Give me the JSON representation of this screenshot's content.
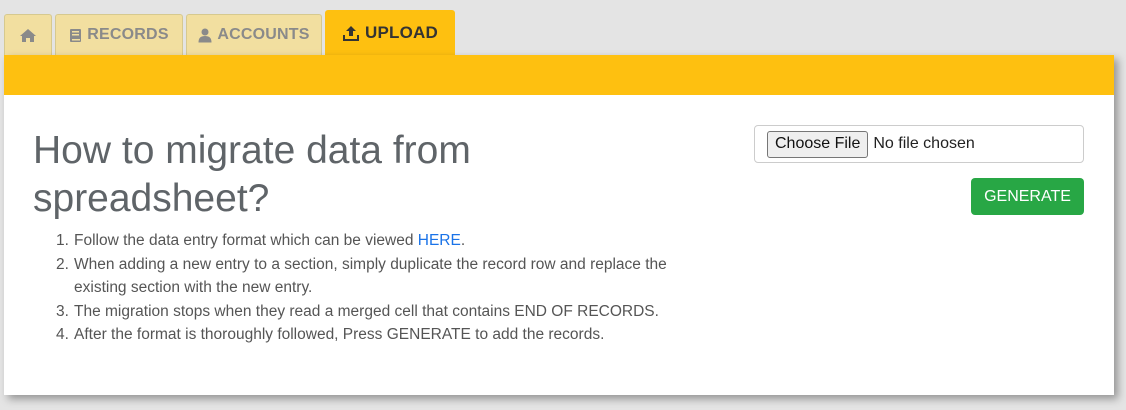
{
  "tabs": {
    "home": {
      "icon": "home-icon"
    },
    "records": {
      "label": "RECORDS",
      "icon": "book-icon"
    },
    "accounts": {
      "label": "ACCOUNTS",
      "icon": "user-icon"
    },
    "upload": {
      "label": "UPLOAD",
      "icon": "upload-icon",
      "active": true
    }
  },
  "main": {
    "title_line1": "How to migrate data from",
    "title_line2": "spreadsheet?",
    "steps": [
      {
        "num": "1.",
        "text": "Follow the data entry format which can be viewed ",
        "link": "HERE",
        "after": "."
      },
      {
        "num": "2.",
        "line1": "When adding a new entry to a section, simply duplicate the record row and replace the",
        "line2": "existing section with the new entry."
      },
      {
        "num": "3.",
        "text": "The migration stops when they read a merged cell that contains END OF RECORDS."
      },
      {
        "num": "4.",
        "text": "After the format is thoroughly followed, Press GENERATE to add the records."
      }
    ]
  },
  "upload": {
    "choose_file_label": "Choose File",
    "file_status": "No file chosen",
    "generate_label": "GENERATE"
  },
  "colors": {
    "accent": "#fec010",
    "tab_inactive": "#f2dfa0",
    "generate": "#28a745",
    "link": "#1a73e8"
  }
}
